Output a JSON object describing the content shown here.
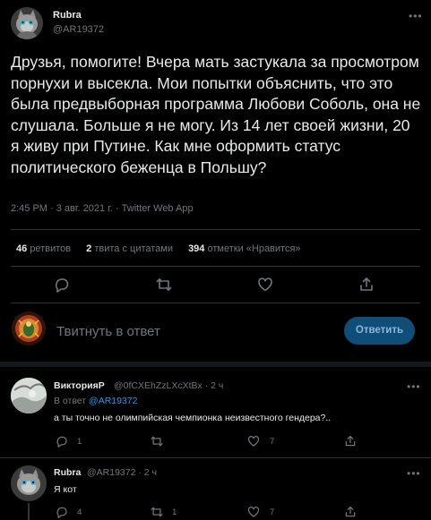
{
  "tweet": {
    "author_name": "Rubra",
    "author_handle": "@AR19372",
    "text": "Друзья, помогите! Вчера мать застукала за просмотром порнухи и высекла. Мои попытки объяснить, что это была предвыборная программа Любови Соболь, она не слушала. Больше я не могу. Из 14 лет своей жизни, 20 я живу при Путине. Как мне оформить статус политического беженца в Польшу?",
    "meta": "2:45 PM · 3 авг. 2021 г. · Twitter Web App",
    "retweets_count": "46",
    "retweets_label": "ретвитов",
    "quotes_count": "2",
    "quotes_label": "твита с цитатами",
    "likes_count": "394",
    "likes_label": "отметки «Нравится»",
    "more_icon": "more-icon"
  },
  "reply_composer": {
    "placeholder": "Твитнуть в ответ",
    "button_label": "Ответить"
  },
  "replies": [
    {
      "name": "ВикторияР",
      "handle_time": "@0fCXEhZzLXcXtBx · 2 ч",
      "reply_to_prefix": "В ответ",
      "reply_to_mention": "@AR19372",
      "text": "а ты точно не олимпийская чемпионка неизвестного гендера?..",
      "reply_count": "1",
      "retweet_count": "",
      "like_count": "7"
    },
    {
      "name": "Rubra",
      "handle_time": "@AR19372 · 2 ч",
      "text": "Я кот",
      "reply_count": "4",
      "retweet_count": "1",
      "like_count": "7"
    }
  ],
  "colors": {
    "background": "#000000",
    "text": "#e7e9ea",
    "muted": "#71767b",
    "accent": "#1d9bf0",
    "button_bg": "#0f4e78"
  }
}
